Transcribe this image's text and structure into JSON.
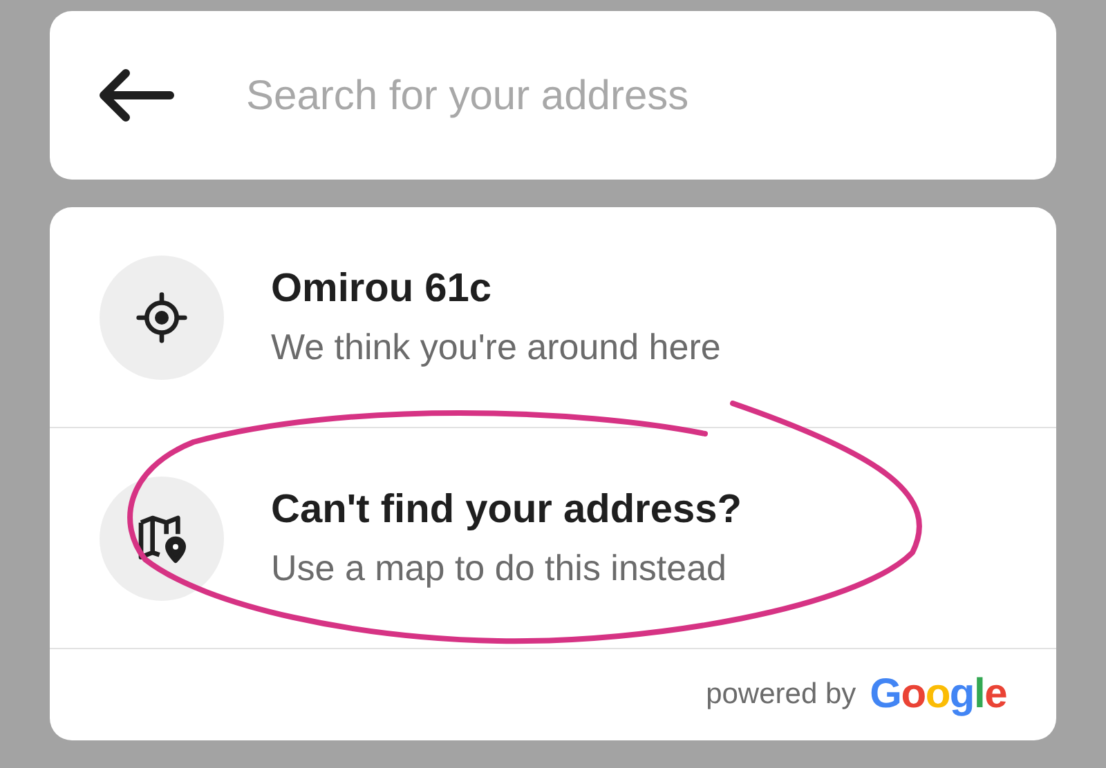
{
  "search": {
    "placeholder": "Search for your address"
  },
  "results": [
    {
      "kind": "location",
      "title": "Omirou 61c",
      "subtitle": "We think you're around here"
    },
    {
      "kind": "map",
      "title": "Can't find your address?",
      "subtitle": "Use a map to do this instead"
    }
  ],
  "footer": {
    "text": "powered by",
    "logo": "Google"
  }
}
